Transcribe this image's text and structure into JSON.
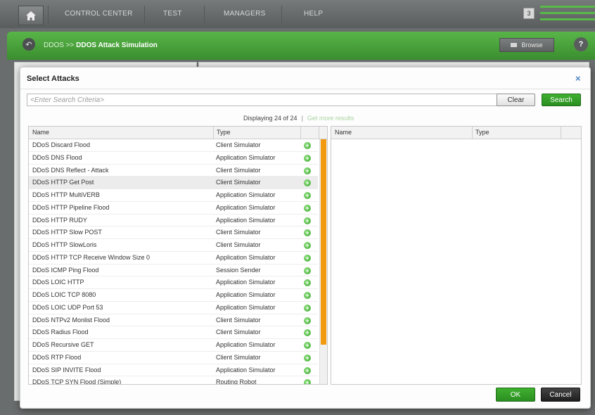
{
  "nav": {
    "items": [
      "CONTROL CENTER",
      "TEST",
      "MANAGERS",
      "HELP"
    ],
    "badge_count": "3"
  },
  "breadcrumb": {
    "parent": "DDOS",
    "separator": ">>",
    "current": "DDOS Attack Simulation",
    "browse_label": "Browse",
    "help_label": "?"
  },
  "dialog": {
    "title": "Select Attacks",
    "close_label": "×",
    "search_placeholder": "<Enter Search Criteria>",
    "clear_label": "Clear",
    "search_label": "Search",
    "display_text": "Displaying 24 of 24",
    "more_results_label": "Get more results",
    "left_columns": [
      "Name",
      "Type"
    ],
    "right_columns": [
      "Name",
      "Type"
    ],
    "ok_label": "OK",
    "cancel_label": "Cancel",
    "add_icon_glyph": "+",
    "rows": [
      {
        "name": "DDoS Discard Flood",
        "type": "Client Simulator"
      },
      {
        "name": "DDoS DNS Flood",
        "type": "Application Simulator"
      },
      {
        "name": "DDoS DNS Reflect - Attack",
        "type": "Client Simulator"
      },
      {
        "name": "DDoS HTTP Get Post",
        "type": "Client Simulator"
      },
      {
        "name": "DDoS HTTP MultiVERB",
        "type": "Application Simulator"
      },
      {
        "name": "DDoS HTTP Pipeline Flood",
        "type": "Application Simulator"
      },
      {
        "name": "DDoS HTTP RUDY",
        "type": "Application Simulator"
      },
      {
        "name": "DDoS HTTP Slow POST",
        "type": "Client Simulator"
      },
      {
        "name": "DDoS HTTP SlowLoris",
        "type": "Client Simulator"
      },
      {
        "name": "DDoS HTTP TCP Receive Window Size 0",
        "type": "Application Simulator"
      },
      {
        "name": "DDoS ICMP Ping Flood",
        "type": "Session Sender"
      },
      {
        "name": "DDoS LOIC HTTP",
        "type": "Application Simulator"
      },
      {
        "name": "DDoS LOIC TCP 8080",
        "type": "Application Simulator"
      },
      {
        "name": "DDoS LOIC UDP Port 53",
        "type": "Application Simulator"
      },
      {
        "name": "DDoS NTPv2 Monlist Flood",
        "type": "Client Simulator"
      },
      {
        "name": "DDoS Radius Flood",
        "type": "Client Simulator"
      },
      {
        "name": "DDoS Recursive GET",
        "type": "Application Simulator"
      },
      {
        "name": "DDoS RTP Flood",
        "type": "Client Simulator"
      },
      {
        "name": "DDoS SIP INVITE Flood",
        "type": "Application Simulator"
      },
      {
        "name": "DDoS TCP SYN Flood (Simple)",
        "type": "Routing Robot"
      }
    ]
  },
  "icons": {
    "home": "home-icon",
    "back": "back-arrow-icon",
    "add": "add-circle-icon"
  },
  "colors": {
    "accent_green": "#3fb02f",
    "scroll_thumb": "#f39a13",
    "link_blue": "#4c86c6"
  }
}
